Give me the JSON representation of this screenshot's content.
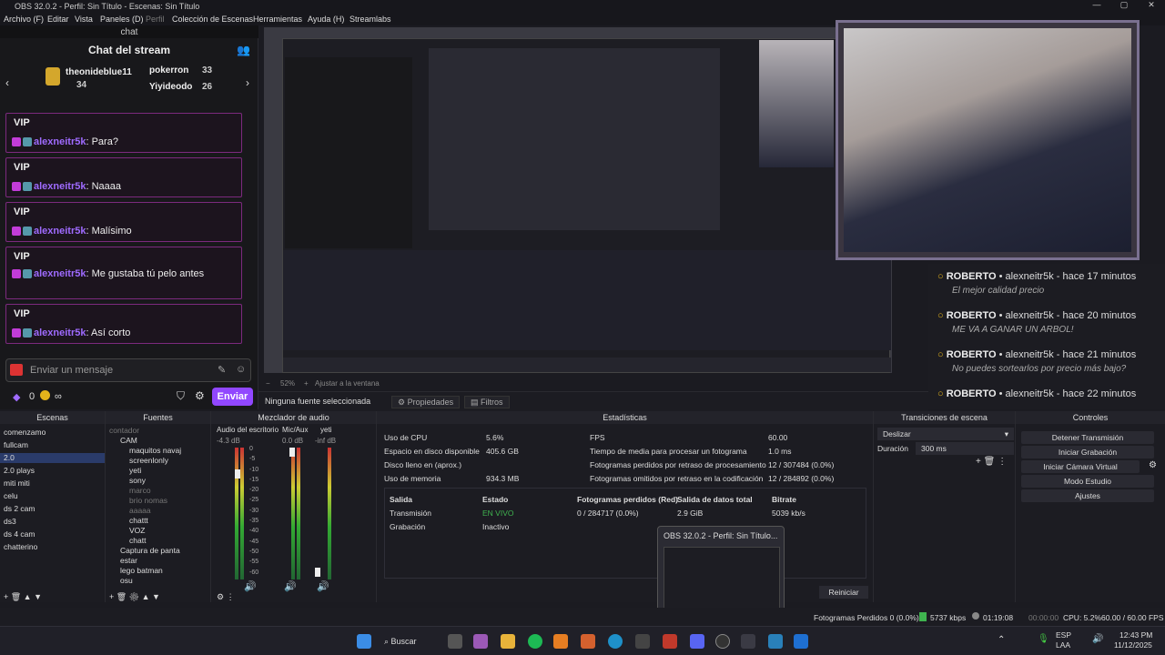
{
  "window": {
    "title": "OBS 32.0.2 - Perfil: Sin Título - Escenas: Sin Título"
  },
  "menu": [
    "Archivo (F)",
    "Editar",
    "Vista",
    "Paneles (D)",
    "Perfil",
    "Colección de Escenas",
    "Herramientas",
    "Ayuda (H)",
    "Streamlabs"
  ],
  "chat": {
    "tab": "chat",
    "title": "Chat del stream",
    "leaders": [
      {
        "name": "theonideblue11",
        "count": "34"
      },
      {
        "name": "pokerron",
        "count": "33"
      },
      {
        "name": "Yiyideodo",
        "count": "26"
      }
    ],
    "messages": [
      {
        "tag": "VIP",
        "user": "alexneitr5k",
        "text": ": Para?"
      },
      {
        "tag": "VIP",
        "user": "alexneitr5k",
        "text": ": Naaaa"
      },
      {
        "tag": "VIP",
        "user": "alexneitr5k",
        "text": ": Malísimo"
      },
      {
        "tag": "VIP",
        "user": "alexneitr5k",
        "text": ": Me gustaba tú pelo antes"
      },
      {
        "tag": "VIP",
        "user": "alexneitr5k",
        "text": ": Así corto"
      }
    ],
    "input_placeholder": "Enviar un mensaje",
    "points": "0",
    "infinity": "∞",
    "send": "Enviar"
  },
  "right_chat": [
    {
      "user": "ROBERTO",
      "channel": "alexneitr5k",
      "time": "hace 17 minutos",
      "text": "El mejor calidad precio"
    },
    {
      "user": "ROBERTO",
      "channel": "alexneitr5k",
      "time": "hace 20 minutos",
      "text": "ME VA A GANAR UN ARBOL!"
    },
    {
      "user": "ROBERTO",
      "channel": "alexneitr5k",
      "time": "hace 21 minutos",
      "text": "No puedes sortearlos por precio más bajo?"
    },
    {
      "user": "ROBERTO",
      "channel": "alexneitr5k",
      "time": "hace 22 minutos",
      "text": ""
    }
  ],
  "preview_bar": {
    "zoom": "52%",
    "fit": "Ajustar a la ventana"
  },
  "source_bar": {
    "none": "Ninguna fuente seleccionada",
    "props": "Propiedades",
    "filters": "Filtros"
  },
  "docks": {
    "scenes": "Escenas",
    "sources": "Fuentes",
    "mixer": "Mezclador de audio",
    "stats": "Estadísticas",
    "transitions": "Transiciones de escena",
    "controls": "Controles"
  },
  "scenes": [
    "comenzamo",
    "fullcam",
    "2.0",
    "2.0 plays",
    "miti miti",
    "celu",
    "ds 2 cam",
    "ds3",
    "ds 4 cam",
    "chatterino"
  ],
  "selected_scene": "2.0",
  "sources": [
    {
      "name": "contador",
      "dim": true
    },
    {
      "name": "CAM",
      "dim": false
    },
    {
      "name": "maquitos navaj",
      "dim": false
    },
    {
      "name": "screenlonly",
      "dim": false
    },
    {
      "name": "yeti",
      "dim": false
    },
    {
      "name": "sony",
      "dim": false
    },
    {
      "name": "marco",
      "dim": true
    },
    {
      "name": "brio nomas",
      "dim": true
    },
    {
      "name": "aaaaa",
      "dim": true
    },
    {
      "name": "chattt",
      "dim": false
    },
    {
      "name": "VOZ",
      "dim": false
    },
    {
      "name": "chatt",
      "dim": false
    },
    {
      "name": "Captura de panta",
      "dim": false
    },
    {
      "name": "estar",
      "dim": false
    },
    {
      "name": "lego batman",
      "dim": false
    },
    {
      "name": "osu",
      "dim": false
    }
  ],
  "mixer": [
    {
      "name": "Audio del escritorio",
      "db": "-4.3 dB"
    },
    {
      "name": "Mic/Aux",
      "db": "0.0 dB"
    },
    {
      "name": "yeti",
      "db": "-inf dB"
    }
  ],
  "mixer_ticks": [
    "0",
    "-5",
    "-10",
    "-15",
    "-20",
    "-25",
    "-30",
    "-35",
    "-40",
    "-45",
    "-50",
    "-55",
    "-60"
  ],
  "stats": {
    "rows": [
      [
        "Uso de CPU",
        "5.6%",
        "FPS",
        "60.00"
      ],
      [
        "Espacio en disco disponible",
        "405.6 GB",
        "Tiempo de media para procesar un fotograma",
        "1.0 ms"
      ],
      [
        "Disco lleno en (aprox.)",
        "",
        "Fotogramas perdidos por retraso de procesamiento",
        "12 / 307484 (0.0%)"
      ],
      [
        "Uso de memoria",
        "934.3 MB",
        "Fotogramas omitidos por retraso en la codificación",
        "12 / 284892 (0.0%)"
      ]
    ],
    "out_headers": [
      "Salida",
      "Estado",
      "Fotogramas perdidos (Red)",
      "Salida de datos total",
      "Bitrate"
    ],
    "out_rows": [
      [
        "Transmisión",
        "EN VIVO",
        "0 / 284717 (0.0%)",
        "2.9 GiB",
        "5039 kb/s"
      ],
      [
        "Grabación",
        "Inactivo",
        "",
        "",
        ""
      ]
    ],
    "reset": "Reiniciar"
  },
  "transitions": {
    "type": "Deslizar",
    "duration_label": "Duración",
    "duration": "300 ms"
  },
  "controls": [
    "Detener Transmisión",
    "Iniciar Grabación",
    "Iniciar Cámara Virtual",
    "Modo Estudio",
    "Ajustes"
  ],
  "popup": {
    "title": "OBS 32.0.2 - Perfil: Sin Título..."
  },
  "status": {
    "dropped": "Fotogramas Perdidos 0 (0.0%)",
    "kbps": "5737 kbps",
    "live_time": "01:19:08",
    "rec_time": "00:00:00",
    "cpu": "CPU: 5.2%",
    "fps": "60.00 / 60.00 FPS"
  },
  "taskbar": {
    "search": "Buscar",
    "lang": "ESP",
    "lang2": "LAA",
    "time": "12:43 PM",
    "date": "11/12/2025"
  }
}
